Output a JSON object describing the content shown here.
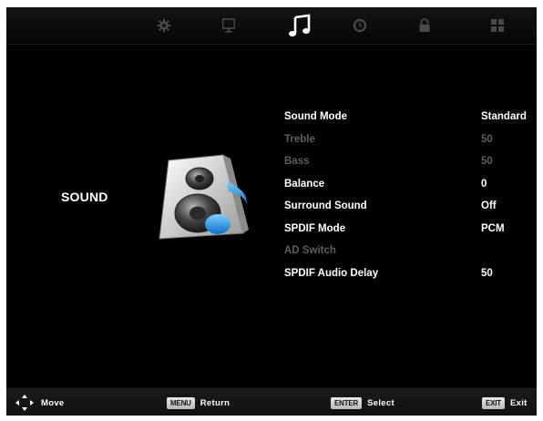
{
  "tabs": [
    {
      "icon": "gear-icon",
      "active": false
    },
    {
      "icon": "monitor-icon",
      "active": false
    },
    {
      "icon": "music-note-icon",
      "active": true
    },
    {
      "icon": "clock-icon",
      "active": false
    },
    {
      "icon": "lock-icon",
      "active": false
    },
    {
      "icon": "grid-icon",
      "active": false
    }
  ],
  "section": {
    "title": "SOUND",
    "icon": "speaker-music-icon"
  },
  "menu": {
    "items": [
      {
        "label": "Sound Mode",
        "value": "Standard",
        "enabled": true
      },
      {
        "label": "Treble",
        "value": "50",
        "enabled": false
      },
      {
        "label": "Bass",
        "value": "50",
        "enabled": false
      },
      {
        "label": "Balance",
        "value": "0",
        "enabled": true
      },
      {
        "label": "Surround Sound",
        "value": "Off",
        "enabled": true
      },
      {
        "label": "SPDIF Mode",
        "value": "PCM",
        "enabled": true
      },
      {
        "label": "AD Switch",
        "value": "",
        "enabled": false
      },
      {
        "label": "SPDIF Audio Delay",
        "value": "50",
        "enabled": true
      }
    ]
  },
  "footer": {
    "move_label": "Move",
    "menu_key": "MENU",
    "return_label": "Return",
    "enter_key": "ENTER",
    "select_label": "Select",
    "exit_key": "EXIT",
    "exit_label": "Exit"
  },
  "colors": {
    "background": "#000000",
    "text": "#ffffff",
    "disabled_text": "#5e5e5e",
    "accent_blue": "#1e90e0"
  }
}
